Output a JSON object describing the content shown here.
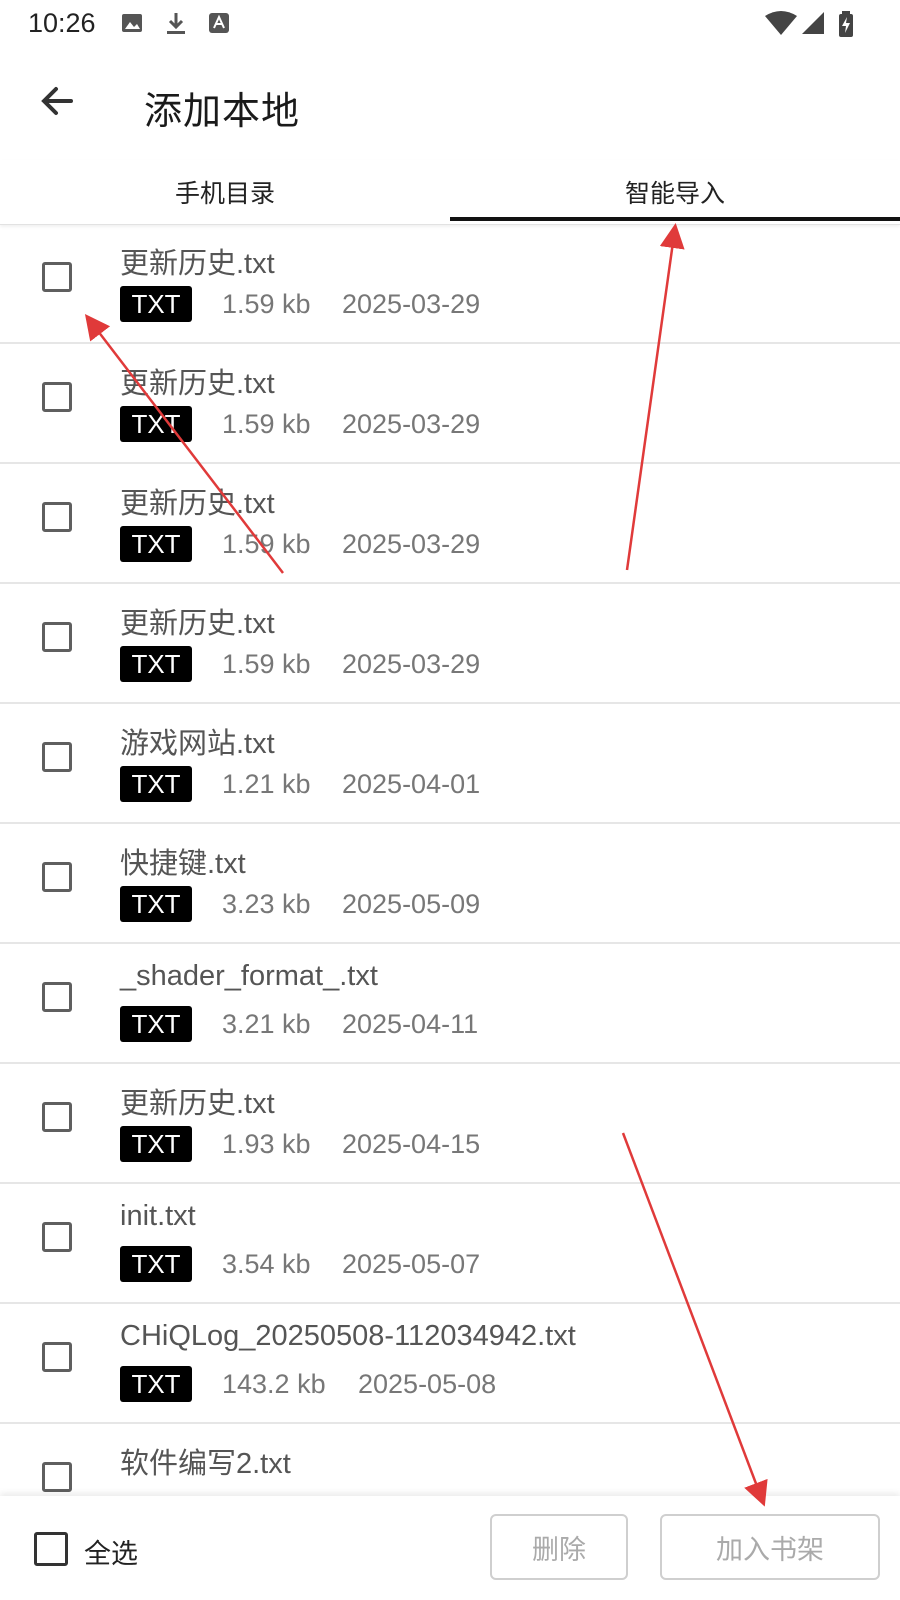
{
  "status_bar": {
    "time": "10:26",
    "left_icons": [
      "image-icon",
      "download-icon",
      "text-icon"
    ],
    "right_icons": [
      "wifi-icon",
      "signal-icon",
      "battery-icon"
    ]
  },
  "header": {
    "back_icon": "arrow-left-icon",
    "title": "添加本地"
  },
  "tabs": [
    {
      "label": "手机目录",
      "selected": false
    },
    {
      "label": "智能导入",
      "selected": true
    }
  ],
  "files": [
    {
      "name": "更新历史.txt",
      "type": "TXT",
      "size": "1.59 kb",
      "date": "2025-03-29"
    },
    {
      "name": "更新历史.txt",
      "type": "TXT",
      "size": "1.59 kb",
      "date": "2025-03-29"
    },
    {
      "name": "更新历史.txt",
      "type": "TXT",
      "size": "1.59 kb",
      "date": "2025-03-29"
    },
    {
      "name": "更新历史.txt",
      "type": "TXT",
      "size": "1.59 kb",
      "date": "2025-03-29"
    },
    {
      "name": "游戏网站.txt",
      "type": "TXT",
      "size": "1.21 kb",
      "date": "2025-04-01"
    },
    {
      "name": "快捷键.txt",
      "type": "TXT",
      "size": "3.23 kb",
      "date": "2025-05-09"
    },
    {
      "name": "_shader_format_.txt",
      "type": "TXT",
      "size": "3.21 kb",
      "date": "2025-04-11"
    },
    {
      "name": "更新历史.txt",
      "type": "TXT",
      "size": "1.93 kb",
      "date": "2025-04-15"
    },
    {
      "name": "init.txt",
      "type": "TXT",
      "size": "3.54 kb",
      "date": "2025-05-07"
    },
    {
      "name": "CHiQLog_20250508-112034942.txt",
      "type": "TXT",
      "size": "143.2 kb",
      "date": "2025-05-08"
    },
    {
      "name": "软件编写2.txt",
      "type": "TXT",
      "size": "",
      "date": ""
    }
  ],
  "footer": {
    "select_all_label": "全选",
    "delete_label": "删除",
    "add_to_shelf_label": "加入书架"
  },
  "colors": {
    "accent": "#111111",
    "annotation": "#e03a3a",
    "badge_bg": "#000000",
    "disabled_text": "#aaaaaa"
  }
}
